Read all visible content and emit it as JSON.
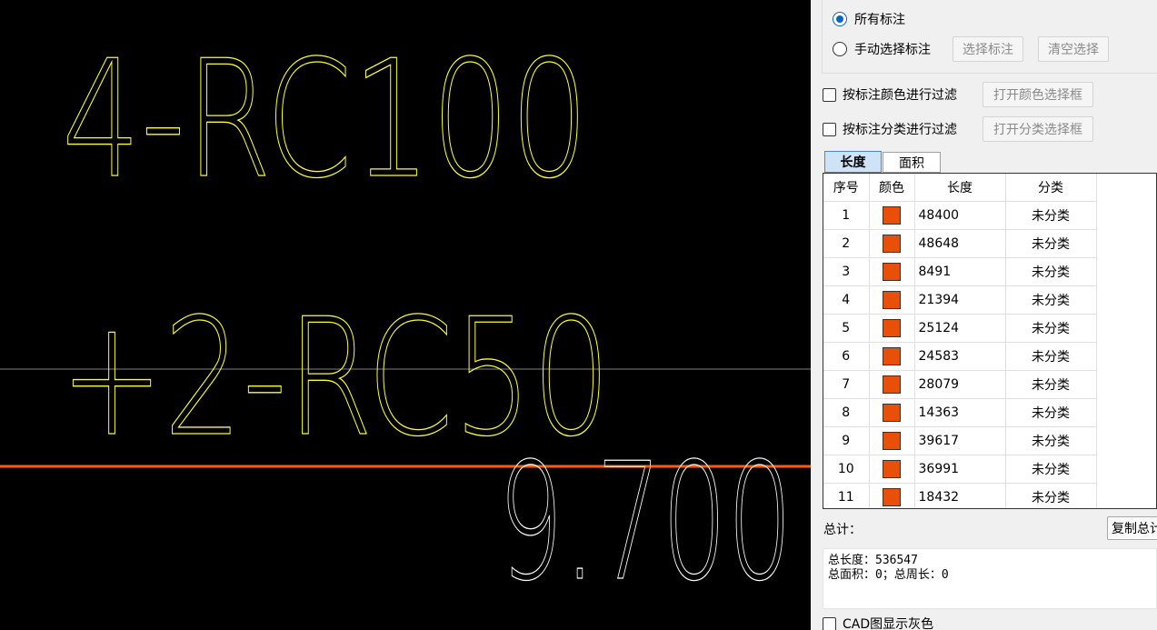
{
  "canvas": {
    "texts": [
      {
        "text": "4-RC100",
        "color": "#ffff33"
      },
      {
        "text": "+2-RC50",
        "color": "#ffff33"
      },
      {
        "text": "9.700",
        "color": "#ffffff"
      }
    ],
    "line_colors": {
      "highlight": "#ff5a14",
      "gray": "#808080"
    }
  },
  "panel": {
    "radio_all": "所有标注",
    "radio_manual": "手动选择标注",
    "btn_select": "选择标注",
    "btn_clear": "清空选择",
    "filter_color_label": "按标注颜色进行过滤",
    "filter_color_btn": "打开颜色选择框",
    "filter_class_label": "按标注分类进行过滤",
    "filter_class_btn": "打开分类选择框",
    "tabs": [
      "长度",
      "面积"
    ],
    "columns": [
      "序号",
      "颜色",
      "长度",
      "分类"
    ],
    "swatch_color": "#e8500a",
    "rows": [
      {
        "no": "1",
        "length": "48400",
        "category": "未分类"
      },
      {
        "no": "2",
        "length": "48648",
        "category": "未分类"
      },
      {
        "no": "3",
        "length": "8491",
        "category": "未分类"
      },
      {
        "no": "4",
        "length": "21394",
        "category": "未分类"
      },
      {
        "no": "5",
        "length": "25124",
        "category": "未分类"
      },
      {
        "no": "6",
        "length": "24583",
        "category": "未分类"
      },
      {
        "no": "7",
        "length": "28079",
        "category": "未分类"
      },
      {
        "no": "8",
        "length": "14363",
        "category": "未分类"
      },
      {
        "no": "9",
        "length": "39617",
        "category": "未分类"
      },
      {
        "no": "10",
        "length": "36991",
        "category": "未分类"
      },
      {
        "no": "11",
        "length": "18432",
        "category": "未分类"
      }
    ],
    "summary_label": "总计：",
    "copy_button": "复制总计",
    "summary_line1": "总长度：536547",
    "summary_line2": "总面积：0；总周长：0",
    "cad_gray_label": "CAD图显示灰色"
  }
}
